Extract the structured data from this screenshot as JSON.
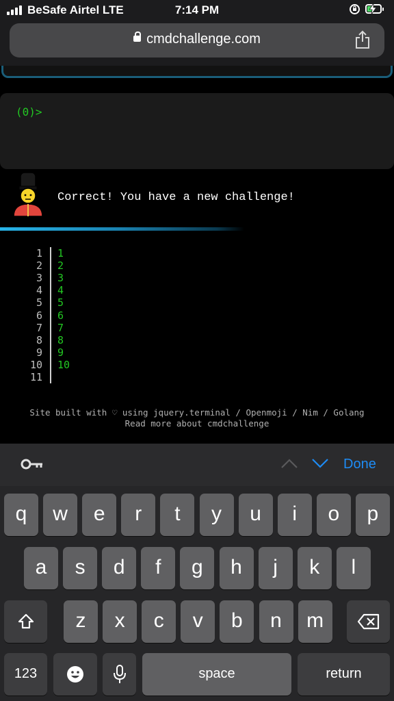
{
  "status": {
    "carrier": "BeSafe Airtel  LTE",
    "time": "7:14 PM"
  },
  "browser": {
    "url": "cmdchallenge.com"
  },
  "terminal": {
    "prompt": "(0)>"
  },
  "result": {
    "message": "Correct! You have a new challenge!"
  },
  "listing": {
    "line_numbers": [
      "1",
      "2",
      "3",
      "4",
      "5",
      "6",
      "7",
      "8",
      "9",
      "10",
      "11"
    ],
    "values": [
      "1",
      "2",
      "3",
      "4",
      "5",
      "6",
      "7",
      "8",
      "9",
      "10"
    ]
  },
  "footer": {
    "line1": "Site built with ♡ using jquery.terminal / Openmoji / Nim / Golang",
    "line2": "Read more about cmdchallenge"
  },
  "accessory": {
    "done_label": "Done",
    "icons": [
      "key-icon",
      "chevron-up-icon",
      "chevron-down-icon"
    ]
  },
  "keyboard": {
    "row1": [
      "q",
      "w",
      "e",
      "r",
      "t",
      "y",
      "u",
      "i",
      "o",
      "p"
    ],
    "row2": [
      "a",
      "s",
      "d",
      "f",
      "g",
      "h",
      "j",
      "k",
      "l"
    ],
    "row3": [
      "z",
      "x",
      "c",
      "v",
      "b",
      "n",
      "m"
    ],
    "numbers_label": "123",
    "space_label": "space",
    "return_label": "return"
  },
  "colors": {
    "terminal_green": "#23c723",
    "accent_blue": "#1e8cf5",
    "divider_blue": "#28b4e8"
  }
}
